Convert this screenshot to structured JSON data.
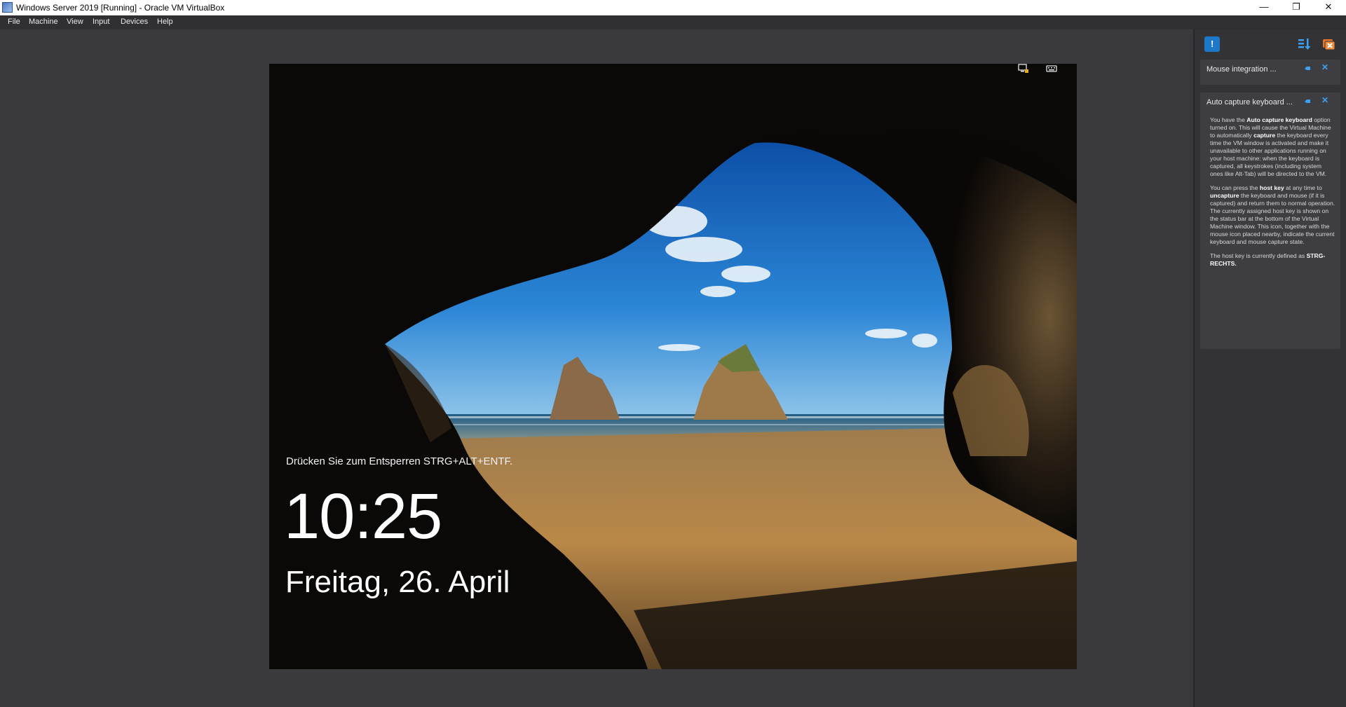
{
  "window": {
    "title": "Windows Server 2019 [Running] - Oracle VM VirtualBox",
    "controls": {
      "minimize": "—",
      "restore": "❐",
      "close": "✕"
    }
  },
  "menu": [
    "File",
    "Machine",
    "View",
    "Input",
    "Devices",
    "Help"
  ],
  "lockscreen": {
    "hint": "Drücken Sie zum Entsperren STRG+ALT+ENTF.",
    "time": "10:25",
    "date": "Freitag, 26. April",
    "icons": [
      "network-icon",
      "keyboard-icon"
    ]
  },
  "notifications": {
    "toolbar_icons": [
      "notification-center-icon",
      "sort-icon",
      "clear-all-icon"
    ],
    "cards": [
      {
        "title": "Mouse integration ..."
      },
      {
        "title": "Auto capture keyboard ...",
        "p1_a": "You have the ",
        "p1_b": "Auto capture keyboard",
        "p1_c": " option turned on. This will cause the Virtual Machine to automatically ",
        "p1_d": "capture",
        "p1_e": " the keyboard every time the VM window is activated and make it unavailable to other applications running on your host machine: when the keyboard is captured, all keystrokes (including system ones like Alt-Tab) will be directed to the VM.",
        "p2_a": "You can press the ",
        "p2_b": "host key",
        "p2_c": " at any time to ",
        "p2_d": "uncapture",
        "p2_e": " the keyboard and mouse (if it is captured) and return them to normal operation. The currently assigned host key is shown on the status bar at the bottom of the Virtual Machine window. This icon, together with the mouse icon placed nearby, indicate the current keyboard and mouse capture state.",
        "p3_a": "The host key is currently defined as ",
        "p3_b": "STRG-RECHTS."
      }
    ]
  },
  "colors": {
    "accent": "#3ea0f2",
    "panel": "#333336",
    "card": "#3e3e42"
  }
}
